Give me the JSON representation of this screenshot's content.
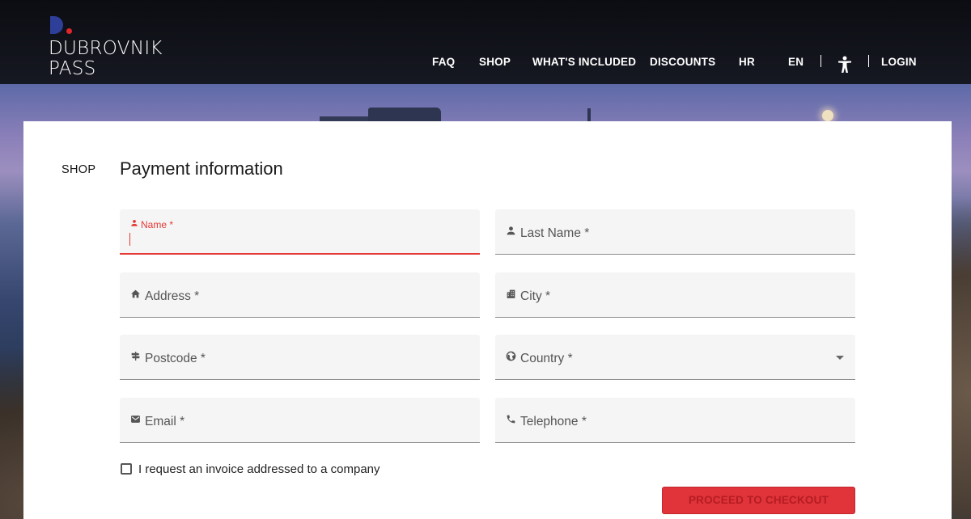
{
  "brand": {
    "line1": "DUBROVNIK",
    "line2": "PASS",
    "colors": {
      "blue": "#2e3f9a",
      "red": "#e0262b"
    }
  },
  "nav": {
    "items": [
      {
        "label": "FAQ"
      },
      {
        "label": "SHOP"
      },
      {
        "label": "WHAT'S INCLUDED"
      },
      {
        "label": "DISCOUNTS"
      },
      {
        "label": "HR"
      },
      {
        "label": "EN"
      }
    ],
    "accessibility_icon": "accessibility-icon",
    "login_label": "LOGIN"
  },
  "page": {
    "breadcrumb": "SHOP",
    "title": "Payment information"
  },
  "form": {
    "fields": [
      {
        "label": "Name *",
        "icon": "person-icon",
        "value": "",
        "state": "focused"
      },
      {
        "label": "Last Name *",
        "icon": "person-icon",
        "value": ""
      },
      {
        "label": "Address *",
        "icon": "home-icon",
        "value": ""
      },
      {
        "label": "City *",
        "icon": "city-icon",
        "value": ""
      },
      {
        "label": "Postcode *",
        "icon": "signpost-icon",
        "value": ""
      },
      {
        "label": "Country *",
        "icon": "globe-icon",
        "value": "",
        "type": "select"
      },
      {
        "label": "Email *",
        "icon": "mail-icon",
        "value": ""
      },
      {
        "label": "Telephone *",
        "icon": "phone-icon",
        "value": ""
      }
    ],
    "invoice_checkbox": {
      "label": "I request an invoice addressed to a company",
      "checked": false
    },
    "submit_label": "PROCEED TO CHECKOUT",
    "accent_color": "#e53935"
  }
}
